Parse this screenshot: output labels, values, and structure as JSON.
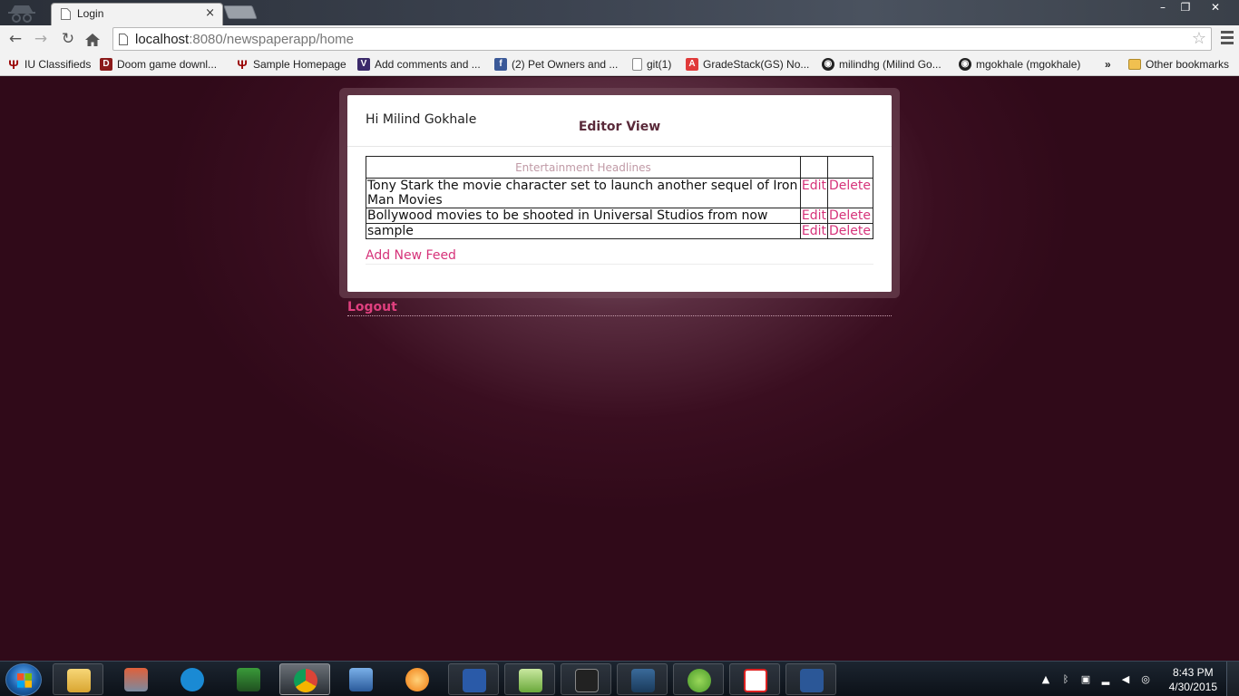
{
  "browser": {
    "tab_title": "Login",
    "tab_close": "×",
    "url_host": "localhost",
    "url_rest": ":8080/newspaperapp/home",
    "window_controls": {
      "minimize": "–",
      "restore": "❐",
      "close": "✕"
    }
  },
  "bookmarks": [
    {
      "label": "IU Classifieds",
      "icon": "iu-icon"
    },
    {
      "label": "Doom game downl...",
      "icon": "doom-icon"
    },
    {
      "label": "Sample Homepage",
      "icon": "iu-icon"
    },
    {
      "label": "Add comments and ...",
      "icon": "vs-icon"
    },
    {
      "label": "(2) Pet Owners and ...",
      "icon": "facebook-icon"
    },
    {
      "label": "git(1)",
      "icon": "page-icon"
    },
    {
      "label": "GradeStack(GS) No...",
      "icon": "gradestack-icon"
    },
    {
      "label": "milindhg (Milind Go...",
      "icon": "github-icon"
    },
    {
      "label": "mgokhale (mgokhale)",
      "icon": "github-icon"
    }
  ],
  "bookmarks_overflow": "»",
  "other_bookmarks": "Other bookmarks",
  "page": {
    "greeting": "Hi Milind Gokhale",
    "view_title": "Editor View",
    "table_header": "Entertainment Headlines",
    "rows": [
      {
        "headline": "Tony Stark the movie character set to launch another sequel of Iron Man Movies",
        "edit": "Edit",
        "delete": "Delete"
      },
      {
        "headline": "Bollywood movies to be shooted in Universal Studios from now",
        "edit": "Edit",
        "delete": "Delete"
      },
      {
        "headline": "sample",
        "edit": "Edit",
        "delete": "Delete"
      }
    ],
    "add_feed": "Add New Feed",
    "logout": "Logout"
  },
  "taskbar": {
    "time": "8:43 PM",
    "date": "4/30/2015"
  },
  "colors": {
    "accent_link": "#d6337a",
    "background": "#2c0a17",
    "header_text": "#5a2a3a"
  }
}
